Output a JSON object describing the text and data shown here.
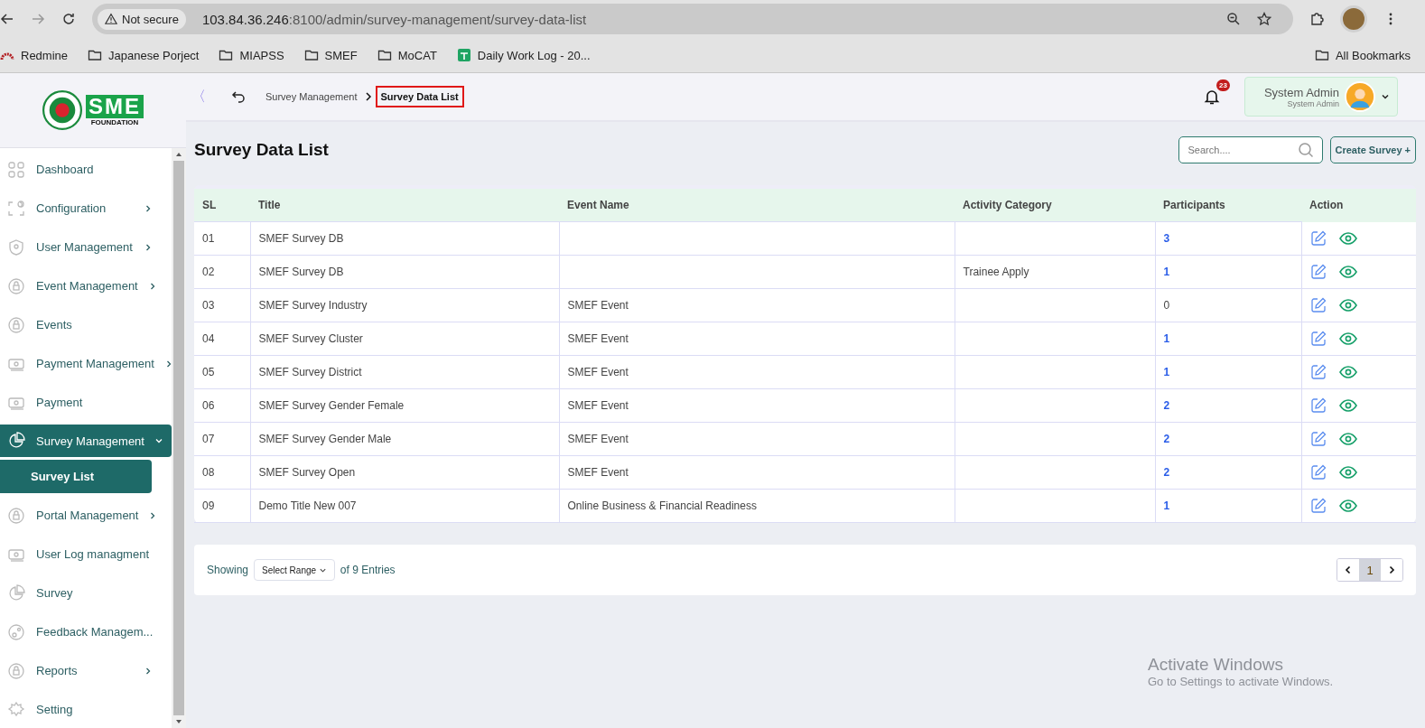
{
  "browser": {
    "security": "Not secure",
    "url_host": "103.84.36.246",
    "url_path": ":8100/admin/survey-management/survey-data-list",
    "bookmarks": [
      {
        "label": "Redmine",
        "kind": "site"
      },
      {
        "label": "Japanese Porject",
        "kind": "folder"
      },
      {
        "label": "MIAPSS",
        "kind": "folder"
      },
      {
        "label": "SMEF",
        "kind": "folder"
      },
      {
        "label": "MoCAT",
        "kind": "folder"
      },
      {
        "label": "Daily Work Log - 20...",
        "kind": "sheet"
      }
    ],
    "all_bookmarks": "All Bookmarks"
  },
  "logo": {
    "brand": "SME",
    "subtitle": "FOUNDATION"
  },
  "sidebar": {
    "items": [
      {
        "label": "Dashboard",
        "kind": "grid",
        "selected": false
      },
      {
        "label": "Configuration",
        "kind": "config",
        "selected": false,
        "expanded": false
      },
      {
        "label": "User Management",
        "kind": "shield",
        "selected": false,
        "expanded": false
      },
      {
        "label": "Event Management",
        "kind": "lock",
        "selected": false,
        "expanded": false
      },
      {
        "label": "Events",
        "kind": "lock",
        "selected": false
      },
      {
        "label": "Payment Management",
        "kind": "money",
        "selected": false,
        "expanded": false
      },
      {
        "label": "Payment",
        "kind": "money",
        "selected": false
      },
      {
        "label": "Survey Management",
        "kind": "pie",
        "selected": true,
        "expanded": true,
        "children": [
          {
            "label": "Survey List",
            "selected": true
          }
        ]
      },
      {
        "label": "Portal Management",
        "kind": "lock",
        "selected": false,
        "expanded": false
      },
      {
        "label": "User Log managment",
        "kind": "money",
        "selected": false
      },
      {
        "label": "Survey",
        "kind": "pie",
        "selected": false
      },
      {
        "label": "Feedback Managem...",
        "kind": "feedback",
        "selected": false
      },
      {
        "label": "Reports",
        "kind": "lock",
        "selected": false,
        "expanded": false
      },
      {
        "label": "Setting",
        "kind": "gear",
        "selected": false
      }
    ]
  },
  "header": {
    "collapse": "〈",
    "breadcrumb": [
      {
        "label": "Survey Management",
        "selected": false
      },
      {
        "label": "Survey Data List",
        "selected": true
      }
    ],
    "notifications": "23",
    "user": {
      "name": "System Admin",
      "role": "System Admin"
    }
  },
  "page": {
    "title": "Survey Data List",
    "search": {
      "placeholder": "Search...."
    },
    "create_button": "Create Survey +"
  },
  "table": {
    "columns": [
      "SL",
      "Title",
      "Event Name",
      "Activity Category",
      "Participants",
      "Action"
    ],
    "rows": [
      {
        "sl": "01",
        "title": "SMEF Survey DB",
        "participants": "3",
        "linked": true
      },
      {
        "sl": "02",
        "title": "SMEF Survey DB",
        "category": "Trainee Apply",
        "participants": "1",
        "linked": true
      },
      {
        "sl": "03",
        "title": "SMEF Survey Industry",
        "event": "SMEF Event",
        "participants": "0",
        "linked": false
      },
      {
        "sl": "04",
        "title": "SMEF Survey Cluster",
        "event": "SMEF Event",
        "participants": "1",
        "linked": true
      },
      {
        "sl": "05",
        "title": "SMEF Survey District",
        "event": "SMEF Event",
        "participants": "1",
        "linked": true
      },
      {
        "sl": "06",
        "title": "SMEF Survey Gender Female",
        "event": "SMEF Event",
        "participants": "2",
        "linked": true
      },
      {
        "sl": "07",
        "title": "SMEF Survey Gender Male",
        "event": "SMEF Event",
        "participants": "2",
        "linked": true
      },
      {
        "sl": "08",
        "title": "SMEF Survey Open",
        "event": "SMEF Event",
        "participants": "2",
        "linked": true
      },
      {
        "sl": "09",
        "title": "Demo Title New 007",
        "event": "Online Business & Financial Readiness",
        "participants": "1",
        "linked": true
      }
    ]
  },
  "footer": {
    "showing": "Showing",
    "range": "Select Range",
    "entries": "of 9 Entries",
    "pages": [
      {
        "label": "1",
        "selected": true
      }
    ]
  },
  "os_notice": {
    "title": "Activate Windows",
    "text": "Go to Settings to activate Windows."
  }
}
